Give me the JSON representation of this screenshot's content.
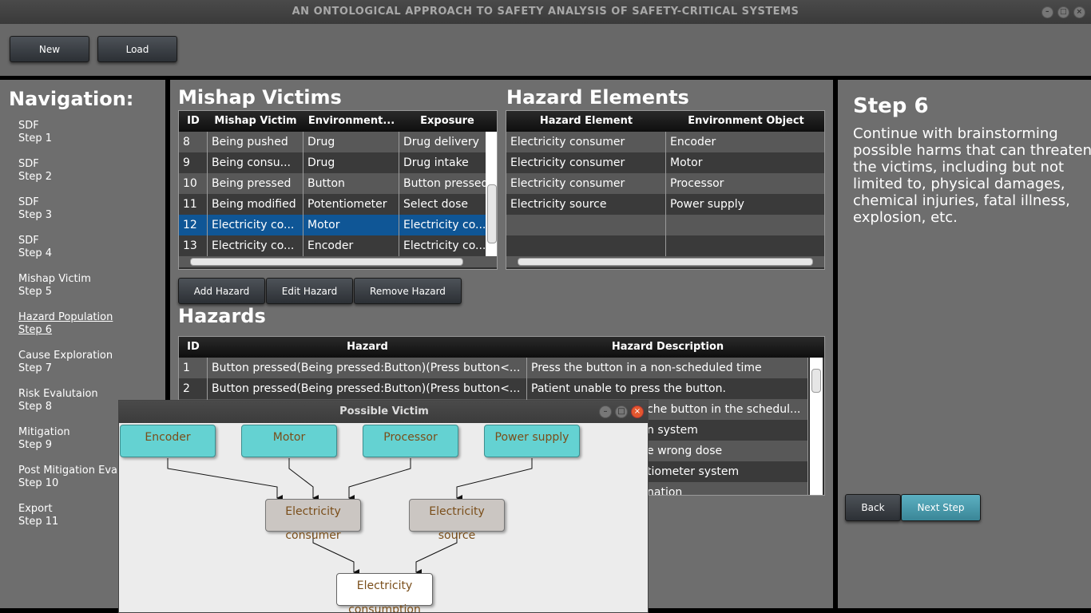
{
  "window": {
    "title": "AN ONTOLOGICAL APPROACH TO SAFETY ANALYSIS OF SAFETY-CRITICAL SYSTEMS"
  },
  "toolbar": {
    "new_label": "New",
    "load_label": "Load"
  },
  "navigation": {
    "title": "Navigation:",
    "items": [
      {
        "name": "SDF",
        "step": "Step 1"
      },
      {
        "name": "SDF",
        "step": "Step 2"
      },
      {
        "name": "SDF",
        "step": "Step 3"
      },
      {
        "name": "SDF",
        "step": "Step 4"
      },
      {
        "name": "Mishap Victim",
        "step": "Step 5"
      },
      {
        "name": "Hazard Population",
        "step": "Step 6"
      },
      {
        "name": "Cause Exploration",
        "step": "Step 7"
      },
      {
        "name": "Risk Evalutaion",
        "step": "Step 8"
      },
      {
        "name": "Mitigation",
        "step": "Step 9"
      },
      {
        "name": "Post Mitigation Eva",
        "step": "Step 10"
      },
      {
        "name": "Export",
        "step": "Step 11"
      }
    ]
  },
  "mishap_victims": {
    "title": "Mishap Victims",
    "columns": [
      "ID",
      "Mishap Victim",
      "Environment...",
      "Exposure"
    ],
    "rows": [
      [
        "8",
        "Being pushed",
        "Drug",
        "Drug delivery"
      ],
      [
        "9",
        "Being consu...",
        "Drug",
        "Drug intake"
      ],
      [
        "10",
        "Being pressed",
        "Button",
        "Button pressed"
      ],
      [
        "11",
        "Being modified",
        "Potentiometer",
        "Select dose"
      ],
      [
        "12",
        "Electricity co...",
        "Motor",
        "Electricity co..."
      ],
      [
        "13",
        "Electricity co...",
        "Encoder",
        "Electricity co..."
      ]
    ],
    "selected_row": 4
  },
  "hazard_elements": {
    "title": "Hazard Elements",
    "columns": [
      "Hazard Element",
      "Environment Object"
    ],
    "rows": [
      [
        "Electricity consumer",
        "Encoder"
      ],
      [
        "Electricity consumer",
        "Motor"
      ],
      [
        "Electricity consumer",
        "Processor"
      ],
      [
        "Electricity source",
        "Power supply"
      ],
      [
        "",
        ""
      ],
      [
        "",
        ""
      ]
    ]
  },
  "hazard_actions": {
    "add": "Add Hazard",
    "edit": "Edit Hazard",
    "remove": "Remove Hazard"
  },
  "hazards": {
    "title": "Hazards",
    "columns": [
      "ID",
      "Hazard",
      "Hazard Description"
    ],
    "rows": [
      [
        "1",
        "Button pressed(Being pressed:Button)(Press button<...",
        "Press the button in a non-scheduled time"
      ],
      [
        "2",
        "Button pressed(Being pressed:Button)(Press button<...",
        "Patient unable to press the button."
      ],
      [
        "",
        "",
        "che button in the schedul..."
      ],
      [
        "",
        "",
        "n system"
      ],
      [
        "",
        "",
        "e wrong dose"
      ],
      [
        "",
        "",
        "tiometer system"
      ],
      [
        "",
        "",
        "nation"
      ]
    ]
  },
  "step": {
    "title": "Step 6",
    "description": "Continue with brainstorming possible harms that can threaten the victims, including but not limited to, physical damages, chemical injuries, fatal illness, explosion, etc."
  },
  "footer": {
    "back_label": "Back",
    "next_label": "Next Step"
  },
  "dialog": {
    "title": "Possible Victim",
    "nodes": {
      "encoder": "Encoder",
      "motor": "Motor",
      "processor": "Processor",
      "power_supply": "Power supply",
      "electricity_consumer": "Electricity consumer",
      "electricity_source": "Electricity source",
      "electricity_consumption": "Electricity consumption"
    }
  },
  "colors": {
    "selection": "#0f5696",
    "next_button": "#4a9eb0",
    "node_cyan": "#64d2d2",
    "node_grey": "#cbc6c2"
  }
}
